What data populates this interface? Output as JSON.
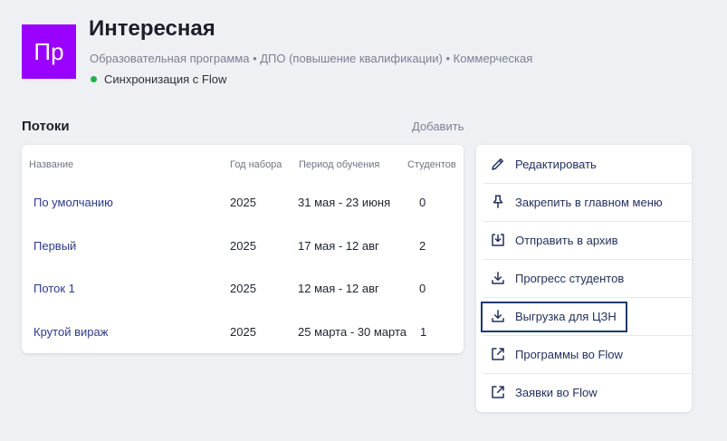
{
  "header": {
    "avatar_text": "Пр",
    "avatar_color": "#9a00ff",
    "title": "Интересная",
    "subtitle": "Образовательная программа • ДПО (повышение квалификации) • Коммерческая",
    "sync_label": "Синхронизация с Flow",
    "sync_status_color": "#22b14c"
  },
  "streams": {
    "section_title": "Потоки",
    "add_label": "Добавить",
    "columns": [
      "Название",
      "Год набора",
      "Период обучения",
      "Студентов"
    ],
    "rows": [
      {
        "name": "По умолчанию",
        "year": "2025",
        "period": "31 мая - 23 июня",
        "students": "0"
      },
      {
        "name": "Первый",
        "year": "2025",
        "period": "17 мая - 12 авг",
        "students": "2"
      },
      {
        "name": "Поток 1",
        "year": "2025",
        "period": "12 мая - 12 авг",
        "students": "0"
      },
      {
        "name": "Крутой вираж",
        "year": "2025",
        "period": "25 марта - 30 марта",
        "students": "1"
      }
    ]
  },
  "actions": {
    "items": [
      {
        "label": "Редактировать",
        "icon": "pencil-icon"
      },
      {
        "label": "Закрепить в главном меню",
        "icon": "pin-icon"
      },
      {
        "label": "Отправить в архив",
        "icon": "archive-icon"
      },
      {
        "label": "Прогресс студентов",
        "icon": "download-icon"
      },
      {
        "label": "Выгрузка для ЦЗН",
        "icon": "download-icon"
      },
      {
        "label": "Программы во Flow",
        "icon": "external-link-icon"
      },
      {
        "label": "Заявки во Flow",
        "icon": "external-link-icon"
      }
    ],
    "focused_item": "Выгрузка для ЦЗН"
  }
}
